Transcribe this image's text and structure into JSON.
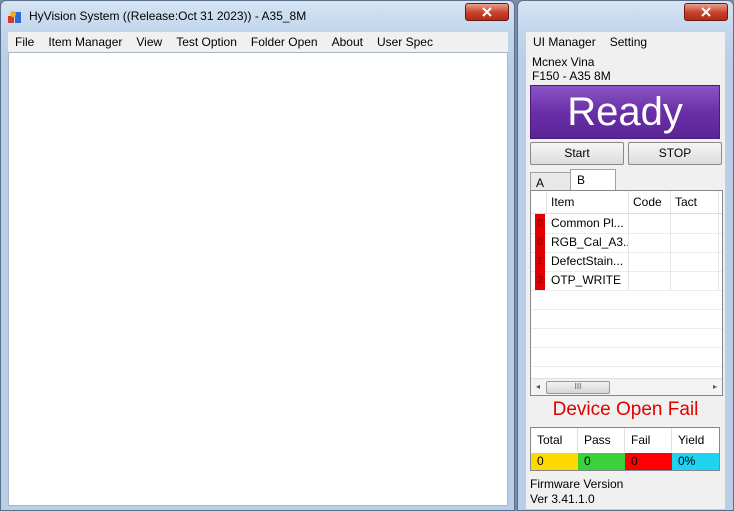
{
  "main_window": {
    "title": "HyVision System ((Release:Oct 31 2023)) - A35_8M",
    "menu": [
      "File",
      "Item Manager",
      "View",
      "Test Option",
      "Folder Open",
      "About",
      "User Spec"
    ]
  },
  "side_window": {
    "menu": [
      "UI Manager",
      "Setting"
    ],
    "company": "Mcnex  Vina",
    "model": "F150 - A35  8M",
    "status_banner": "Ready",
    "start_label": "Start",
    "stop_label": "STOP",
    "tabs": [
      "A",
      "B"
    ],
    "grid_headers": [
      "Item",
      "Code",
      "Tact"
    ],
    "grid_rows": [
      {
        "flag": "0",
        "item": "Common Pl...",
        "code": "",
        "tact": ""
      },
      {
        "flag": "0",
        "item": "RGB_Cal_A3...",
        "code": "",
        "tact": ""
      },
      {
        "flag": "1",
        "item": "DefectStain...",
        "code": "",
        "tact": ""
      },
      {
        "flag": "2",
        "item": "OTP_WRITE",
        "code": "",
        "tact": ""
      }
    ],
    "scroll_left_icon": "◂",
    "scroll_right_icon": "▸",
    "scroll_grip": "III",
    "device_status": "Device Open Fail",
    "stats": {
      "headers": [
        "Total",
        "Pass",
        "Fail",
        "Yield"
      ],
      "values": [
        "0",
        "0",
        "0",
        "0%"
      ],
      "colors": [
        "#ffd800",
        "#3bd13b",
        "#ff0000",
        "#1ed3f0"
      ]
    },
    "firmware_label": "Firmware Version",
    "firmware_version": "Ver 3.41.1.0"
  }
}
